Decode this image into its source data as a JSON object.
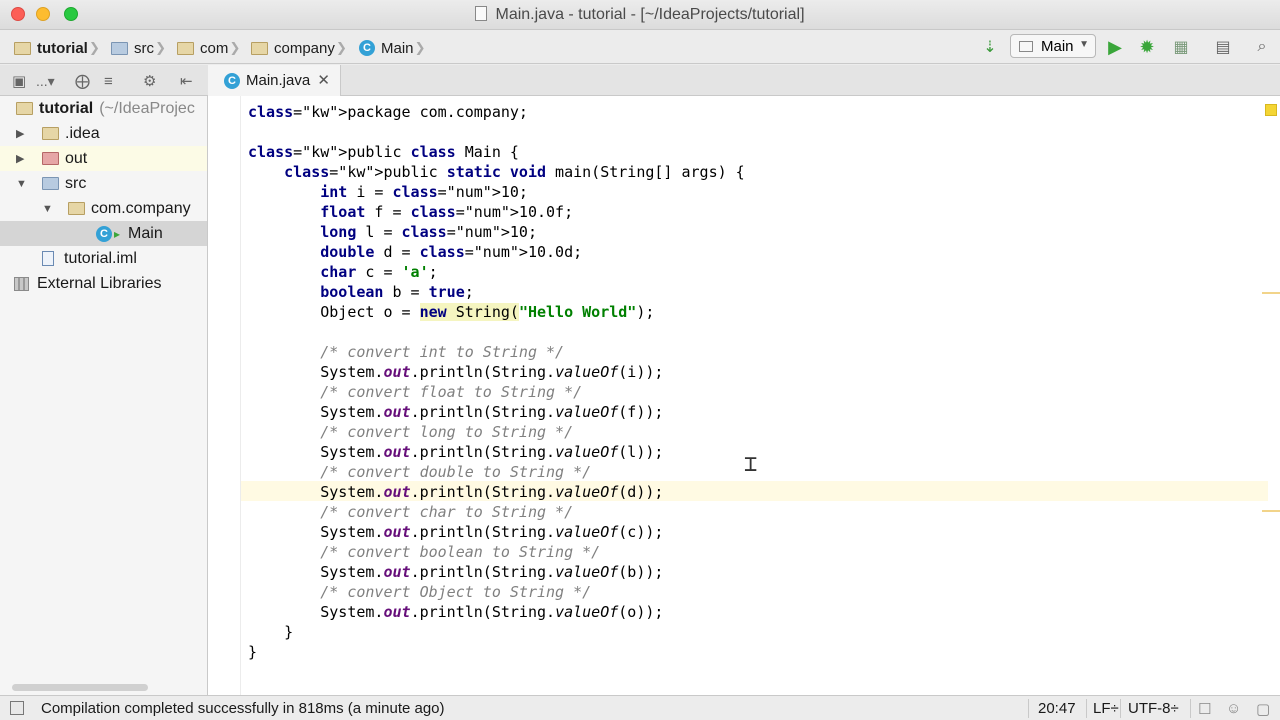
{
  "window": {
    "title": "Main.java - tutorial - [~/IdeaProjects/tutorial]"
  },
  "breadcrumbs": [
    "tutorial",
    "src",
    "com",
    "company",
    "Main"
  ],
  "run_config": {
    "label": "Main"
  },
  "tabs": [
    {
      "label": "Main.java"
    }
  ],
  "project_tree": {
    "root_label": "tutorial",
    "root_path": "(~/IdeaProjec",
    "items": [
      ".idea",
      "out",
      "src",
      "com.company",
      "Main",
      "tutorial.iml",
      "External Libraries"
    ],
    "toolbar_label": "..."
  },
  "code_lines": [
    "package com.company;",
    "",
    "public class Main {",
    "    public static void main(String[] args) {",
    "        int i = 10;",
    "        float f = 10.0f;",
    "        long l = 10;",
    "        double d = 10.0d;",
    "        char c = 'a';",
    "        boolean b = true;",
    "        Object o = new String(\"Hello World\");",
    "",
    "        /* convert int to String */",
    "        System.out.println(String.valueOf(i));",
    "        /* convert float to String */",
    "        System.out.println(String.valueOf(f));",
    "        /* convert long to String */",
    "        System.out.println(String.valueOf(l));",
    "        /* convert double to String */",
    "        System.out.println(String.valueOf(d));",
    "        /* convert char to String */",
    "        System.out.println(String.valueOf(c));",
    "        /* convert boolean to String */",
    "        System.out.println(String.valueOf(b));",
    "        /* convert Object to String */",
    "        System.out.println(String.valueOf(o));",
    "    }",
    "}"
  ],
  "status": {
    "message": "Compilation completed successfully in 818ms (a minute ago)",
    "position": "20:47",
    "line_separator": "LF÷",
    "encoding": "UTF-8÷"
  },
  "colors": {
    "keyword": "#000080",
    "number": "#0000ff",
    "string": "#008000",
    "comment": "#808080",
    "field": "#660e7a",
    "caret_row": "#fffae3"
  }
}
